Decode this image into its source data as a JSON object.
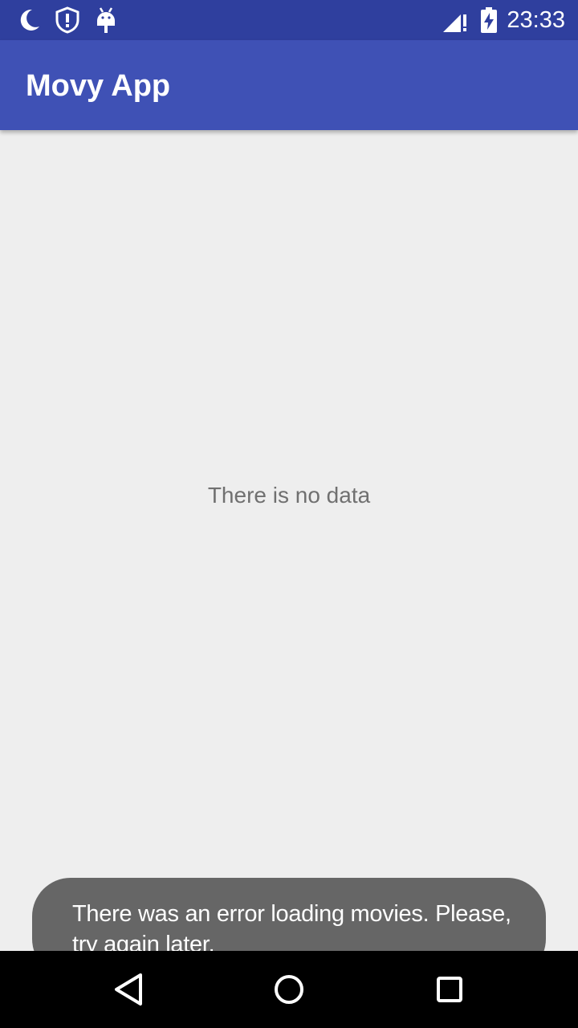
{
  "status_bar": {
    "time": "23:33",
    "icons": [
      "moon-icon",
      "shield-alert-icon",
      "android-debug-icon",
      "signal-alert-icon",
      "battery-charging-icon"
    ],
    "background": "#2f3f9e"
  },
  "app_bar": {
    "title": "Movy App",
    "background": "#3f51b5"
  },
  "main": {
    "empty_message": "There is no data"
  },
  "toast": {
    "message": "There was an error loading movies. Please, try again later."
  },
  "nav_bar": {
    "buttons": [
      "back-icon",
      "home-icon",
      "recents-icon"
    ]
  }
}
